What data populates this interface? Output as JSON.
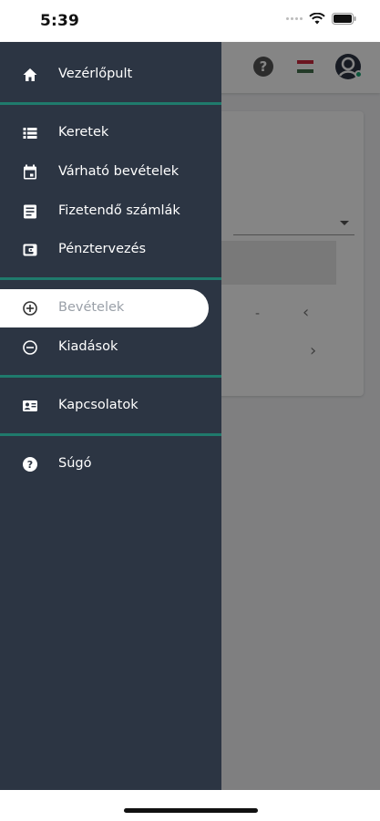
{
  "status_bar": {
    "time": "5:39"
  },
  "drawer": {
    "items": [
      {
        "label": "Vezérlőpult",
        "icon": "home-icon"
      },
      {
        "label": "Keretek",
        "icon": "list-icon"
      },
      {
        "label": "Várható bevételek",
        "icon": "calendar-icon"
      },
      {
        "label": "Fizetendő számlák",
        "icon": "document-icon"
      },
      {
        "label": "Pénztervezés",
        "icon": "wallet-icon"
      },
      {
        "label": "Bevételek",
        "icon": "plus-circle-icon",
        "active": true
      },
      {
        "label": "Kiadások",
        "icon": "minus-circle-icon"
      },
      {
        "label": "Kapcsolatok",
        "icon": "contact-card-icon"
      },
      {
        "label": "Súgó",
        "icon": "help-circle-icon"
      }
    ]
  },
  "background": {
    "header_icons": [
      "help-icon",
      "hungarian-flag-icon",
      "avatar-icon"
    ],
    "card_dash": "-"
  },
  "colors": {
    "drawer_bg": "#2c3543",
    "divider": "#1f7a6c",
    "active_bg": "#ffffff",
    "active_text": "#9aa0a8"
  }
}
